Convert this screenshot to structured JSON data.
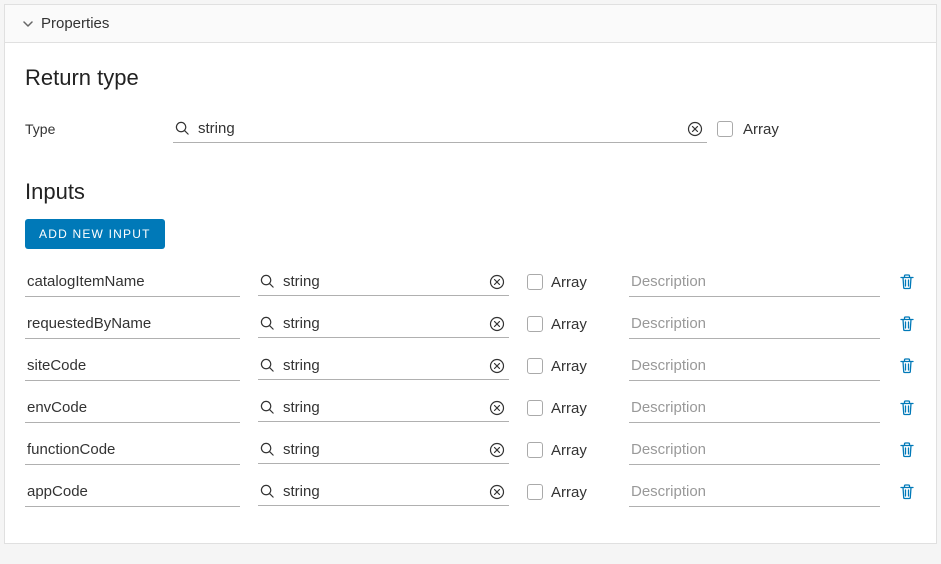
{
  "panel": {
    "title": "Properties"
  },
  "returnType": {
    "heading": "Return type",
    "typeLabel": "Type",
    "typeValue": "string",
    "arrayLabel": "Array"
  },
  "inputs": {
    "heading": "Inputs",
    "addButtonLabel": "ADD NEW INPUT",
    "descPlaceholder": "Description",
    "arrayLabel": "Array",
    "rows": [
      {
        "name": "catalogItemName",
        "type": "string"
      },
      {
        "name": "requestedByName",
        "type": "string"
      },
      {
        "name": "siteCode",
        "type": "string"
      },
      {
        "name": "envCode",
        "type": "string"
      },
      {
        "name": "functionCode",
        "type": "string"
      },
      {
        "name": "appCode",
        "type": "string"
      }
    ]
  }
}
